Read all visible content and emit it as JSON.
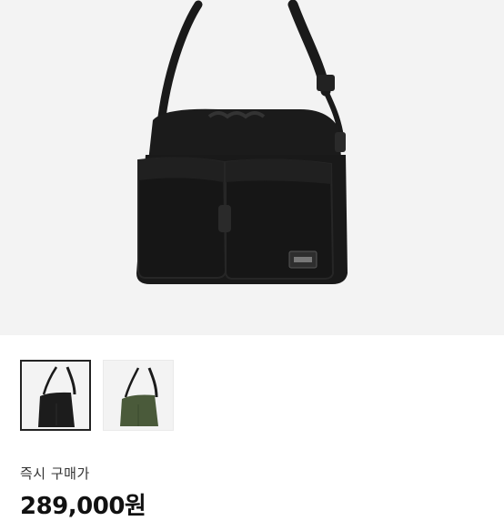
{
  "product": {
    "main_image": "black-shoulder-bag",
    "thumbnails": [
      {
        "name": "black-bag-thumbnail",
        "color": "#1c1c1c",
        "selected": true
      },
      {
        "name": "olive-bag-thumbnail",
        "color": "#4a5a3a",
        "selected": false
      }
    ],
    "instant_buy_label": "즉시 구매가",
    "price": "289,000원"
  },
  "colors": {
    "hero_bg": "#f3f3f3",
    "bag_black": "#1c1c1c",
    "bag_olive": "#4a5a3a",
    "selected_border": "#222222"
  }
}
